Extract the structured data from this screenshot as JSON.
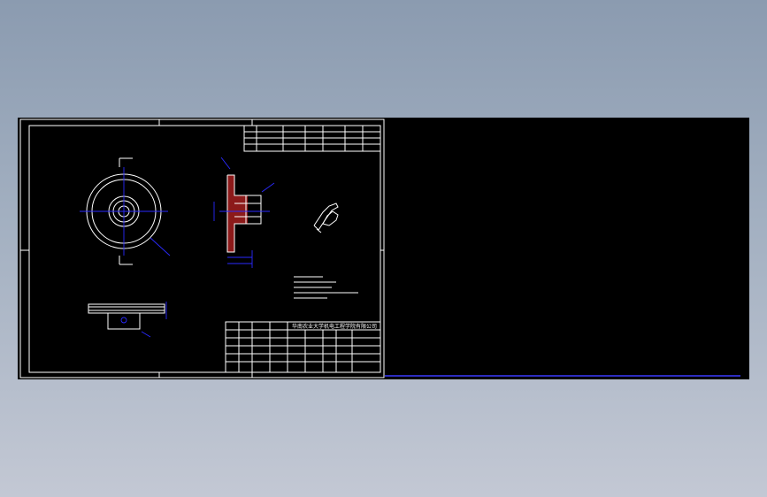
{
  "title_block": {
    "company": "华南农业大学机电工程学院有限公司"
  },
  "colors": {
    "drawing_bg": "#000000",
    "line_white": "#ffffff",
    "line_blue": "#2a2aff",
    "line_red": "#ff3030"
  }
}
